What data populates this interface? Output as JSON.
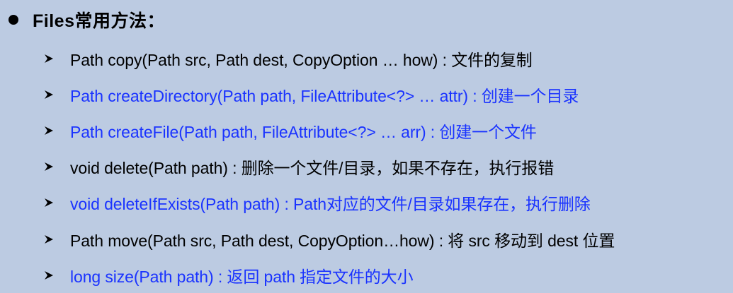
{
  "heading": {
    "text": "Files常用方法："
  },
  "colors": {
    "background": "#bccbe2",
    "black": "#000000",
    "blue": "#1a33ff"
  },
  "items": [
    {
      "text": "Path copy(Path src, Path dest, CopyOption … how) : 文件的复制",
      "color": "#000000"
    },
    {
      "text": "Path createDirectory(Path path, FileAttribute<?> … attr) : 创建一个目录",
      "color": "#1a33ff"
    },
    {
      "text": "Path createFile(Path path, FileAttribute<?> … arr) : 创建一个文件",
      "color": "#1a33ff"
    },
    {
      "text": "void delete(Path path) : 删除一个文件/目录，如果不存在，执行报错",
      "color": "#000000"
    },
    {
      "text": "void deleteIfExists(Path path) : Path对应的文件/目录如果存在，执行删除",
      "color": "#1a33ff"
    },
    {
      "text": "Path move(Path src, Path dest, CopyOption…how) : 将 src 移动到 dest 位置",
      "color": "#000000"
    },
    {
      "text": "long size(Path path) : 返回 path 指定文件的大小",
      "color": "#1a33ff"
    }
  ]
}
